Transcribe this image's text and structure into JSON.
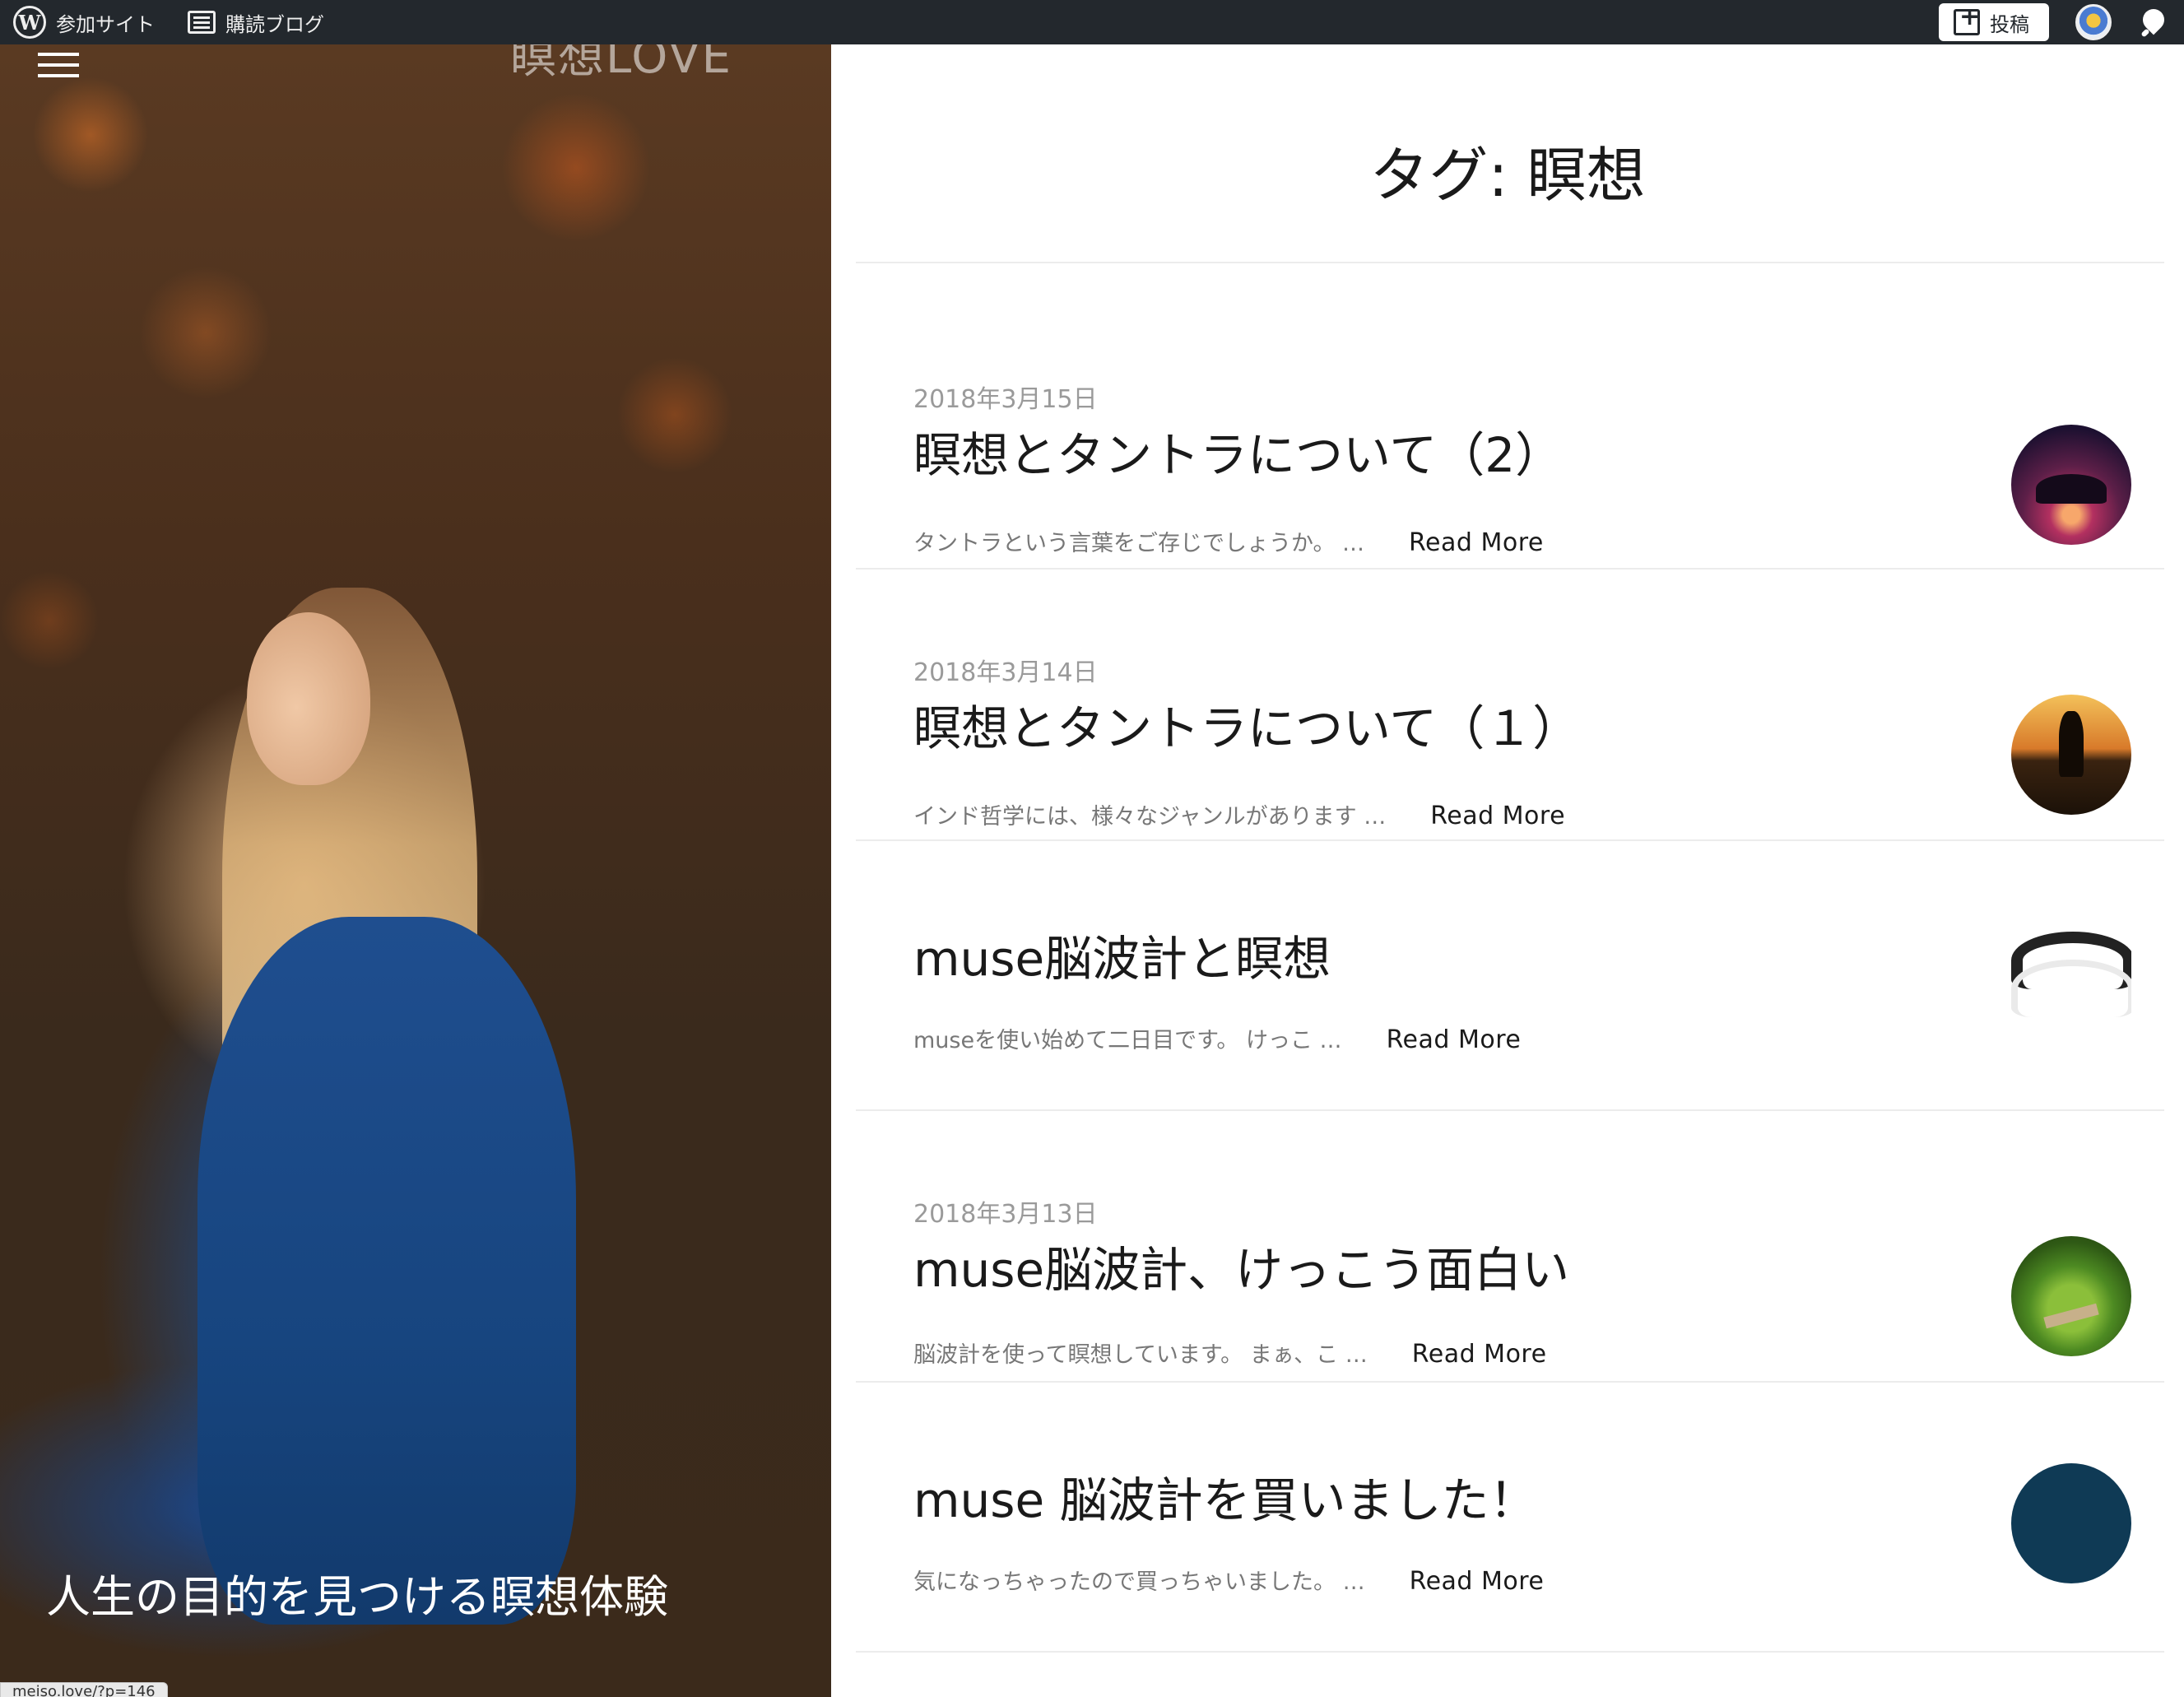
{
  "adminbar": {
    "site_label": "参加サイト",
    "reader_label": "購読ブログ",
    "post_label": "投稿"
  },
  "hero": {
    "site_title": "瞑想LOVE",
    "caption": "人生の目的を見つける瞑想体験",
    "status_url": "meiso.love/?p=146"
  },
  "page": {
    "title": "タグ: 瞑想"
  },
  "posts": [
    {
      "date": "2018年3月15日",
      "title": "瞑想とタントラについて（2）",
      "excerpt": "タントラという言葉をご存じでしょうか。 …",
      "read_more": "Read More"
    },
    {
      "date": "2018年3月14日",
      "title": "瞑想とタントラについて（１）",
      "excerpt": "インド哲学には、様々なジャンルがあります …",
      "read_more": "Read More"
    },
    {
      "date": "",
      "title": "muse脳波計と瞑想",
      "excerpt": "museを使い始めて二日目です。 けっこ …",
      "read_more": "Read More"
    },
    {
      "date": "2018年3月13日",
      "title": "muse脳波計、けっこう面白い",
      "excerpt": "脳波計を使って瞑想しています。 まぁ、こ …",
      "read_more": "Read More"
    },
    {
      "date": "",
      "title": "muse 脳波計を買いました！",
      "excerpt": "気になっちゃったので買っちゃいました。 …",
      "read_more": "Read More"
    }
  ]
}
